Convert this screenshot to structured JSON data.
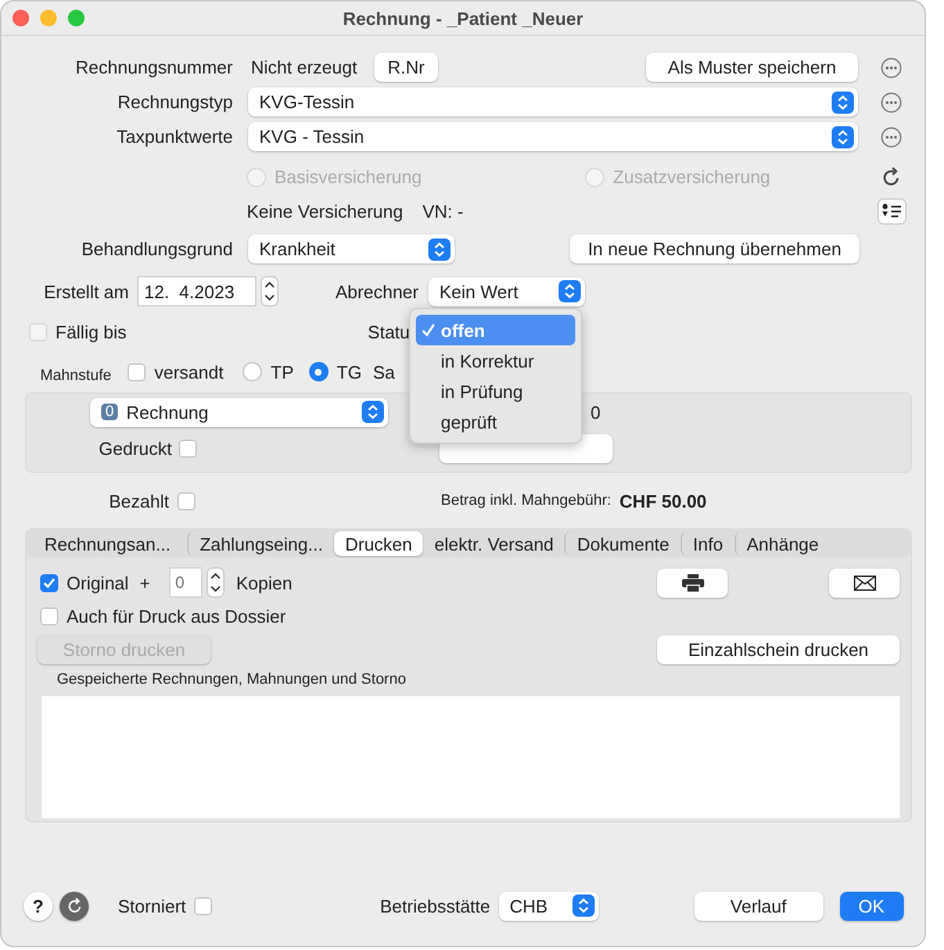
{
  "window": {
    "title": "Rechnung - _Patient _Neuer"
  },
  "invoice_number": {
    "label": "Rechnungsnummer",
    "value": "Nicht erzeugt",
    "button": "R.Nr",
    "save_button": "Als Muster speichern"
  },
  "invoice_type": {
    "label": "Rechnungstyp",
    "value": "KVG-Tessin"
  },
  "tax_points": {
    "label": "Taxpunktwerte",
    "value": "KVG - Tessin"
  },
  "insurance_radios": [
    {
      "label": "Basisversicherung",
      "selected": false,
      "disabled": true
    },
    {
      "label": "Zusatzversicherung",
      "selected": false,
      "disabled": true
    }
  ],
  "insurance": {
    "text": "Keine Versicherung",
    "vn": "VN: -"
  },
  "treatment": {
    "label": "Behandlungsgrund",
    "value": "Krankheit",
    "button": "In neue Rechnung übernehmen"
  },
  "created": {
    "label": "Erstellt am",
    "value": "12.  4.2023"
  },
  "biller": {
    "label": "Abrechner",
    "value": "Kein Wert"
  },
  "due": {
    "label": "Fällig bis",
    "checked": false
  },
  "status": {
    "label": "Statu"
  },
  "status_menu": [
    {
      "label": "offen",
      "selected": true
    },
    {
      "label": "in Korrektur",
      "selected": false
    },
    {
      "label": "in Prüfung",
      "selected": false
    },
    {
      "label": "geprüft",
      "selected": false
    }
  ],
  "reminder": {
    "label": "Mahnstufe",
    "sent_label": "versandt",
    "sent_checked": false,
    "cut_label": "Sa"
  },
  "recipient_radios": [
    {
      "label": "TP",
      "selected": false
    },
    {
      "label": "TG",
      "selected": true
    }
  ],
  "reminder_panel": {
    "badge": "0",
    "value": "Rechnung",
    "cut_text": "0",
    "printed_label": "Gedruckt",
    "printed_checked": false
  },
  "paid": {
    "label": "Bezahlt",
    "checked": false,
    "amount_label": "Betrag inkl. Mahngebühr:",
    "amount": "CHF 50.00"
  },
  "tabs": [
    {
      "label": "Rechnungsan...",
      "selected": false
    },
    {
      "label": "Zahlungseing...",
      "selected": false
    },
    {
      "label": "Drucken",
      "selected": true
    },
    {
      "label": "elektr. Versand",
      "selected": false
    },
    {
      "label": "Dokumente",
      "selected": false
    },
    {
      "label": "Info",
      "selected": false
    },
    {
      "label": "Anhänge",
      "selected": false
    }
  ],
  "print": {
    "original_label": "Original",
    "original_checked": true,
    "plus": "+",
    "copies_placeholder": "0",
    "copies_label": "Kopien",
    "dossier_label": "Auch für Druck aus Dossier",
    "dossier_checked": false,
    "storno_button": "Storno drucken",
    "storno_disabled": true,
    "slip_button": "Einzahlschein drucken",
    "list_title": "Gespeicherte Rechnungen, Mahnungen und Storno"
  },
  "footer": {
    "help": "?",
    "cancelled_label": "Storniert",
    "cancelled_checked": false,
    "site_label": "Betriebsstätte",
    "site_value": "CHB",
    "history_button": "Verlauf",
    "ok_button": "OK"
  }
}
